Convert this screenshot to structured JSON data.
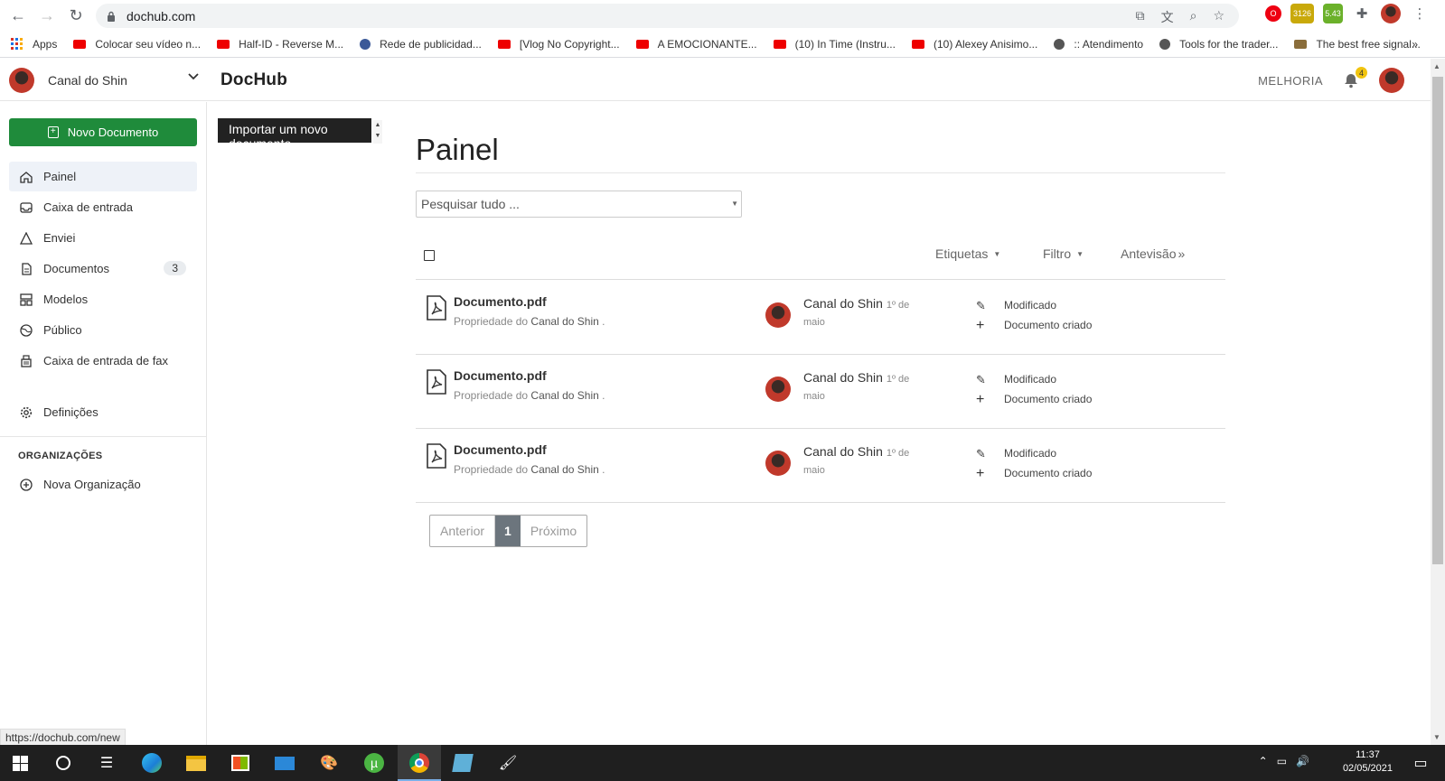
{
  "browser": {
    "url": "dochub.com",
    "status_url": "https://dochub.com/new",
    "ext_badges": [
      "3126",
      "5.43"
    ],
    "bookmarks": [
      {
        "label": "Apps",
        "icon": "apps-icon"
      },
      {
        "label": "Colocar seu vídeo n...",
        "icon": "youtube-icon"
      },
      {
        "label": "Half-ID - Reverse M...",
        "icon": "youtube-icon"
      },
      {
        "label": "Rede de publicidad...",
        "icon": "network-icon"
      },
      {
        "label": "[Vlog No Copyright...",
        "icon": "youtube-icon"
      },
      {
        "label": "A EMOCIONANTE...",
        "icon": "youtube-icon"
      },
      {
        "label": "(10) In Time (Instru...",
        "icon": "youtube-icon"
      },
      {
        "label": "(10) Alexey Anisimo...",
        "icon": "youtube-icon"
      },
      {
        "label": ":: Atendimento",
        "icon": "globe-icon"
      },
      {
        "label": "Tools for the trader...",
        "icon": "globe-icon"
      },
      {
        "label": "The best free signal...",
        "icon": "bookmark-icon"
      }
    ],
    "more_bookmarks": "»"
  },
  "header": {
    "account_name": "Canal do Shin",
    "brand": "DocHub",
    "upgrade": "MELHORIA",
    "notification_count": "4"
  },
  "sidebar": {
    "new_doc": "Novo Documento",
    "tooltip": "Importar um novo documento",
    "items": [
      {
        "label": "Painel",
        "icon": "home-icon"
      },
      {
        "label": "Caixa de entrada",
        "icon": "inbox-icon"
      },
      {
        "label": "Enviei",
        "icon": "sent-icon"
      },
      {
        "label": "Documentos",
        "icon": "document-icon",
        "count": "3"
      },
      {
        "label": "Modelos",
        "icon": "templates-icon"
      },
      {
        "label": "Público",
        "icon": "globe-icon"
      },
      {
        "label": "Caixa de entrada de fax",
        "icon": "fax-icon"
      }
    ],
    "settings": "Definições",
    "org_title": "ORGANIZAÇÕES",
    "new_org": "Nova Organização"
  },
  "main": {
    "title": "Painel",
    "search_placeholder": "Pesquisar tudo ...",
    "labels": "Etiquetas",
    "filter": "Filtro",
    "preview": "Antevisão",
    "rows": [
      {
        "name": "Documento.pdf",
        "owner_prefix": "Propriedade do",
        "owner": "Canal do Shin",
        "owner_suffix": ".",
        "author": "Canal do Shin",
        "date": "1º de maio",
        "act1": "Modificado",
        "act2": "Documento criado"
      },
      {
        "name": "Documento.pdf",
        "owner_prefix": "Propriedade do",
        "owner": "Canal do Shin",
        "owner_suffix": ".",
        "author": "Canal do Shin",
        "date": "1º de maio",
        "act1": "Modificado",
        "act2": "Documento criado"
      },
      {
        "name": "Documento.pdf",
        "owner_prefix": "Propriedade do",
        "owner": "Canal do Shin",
        "owner_suffix": ".",
        "author": "Canal do Shin",
        "date": "1º de maio",
        "act1": "Modificado",
        "act2": "Documento criado"
      }
    ],
    "pager": {
      "prev": "Anterior",
      "current": "1",
      "next": "Próximo"
    }
  },
  "taskbar": {
    "time": "11:37",
    "date": "02/05/2021"
  },
  "colors": {
    "accent_green": "#1f8b3b",
    "badge_yellow": "#f1c40f"
  }
}
